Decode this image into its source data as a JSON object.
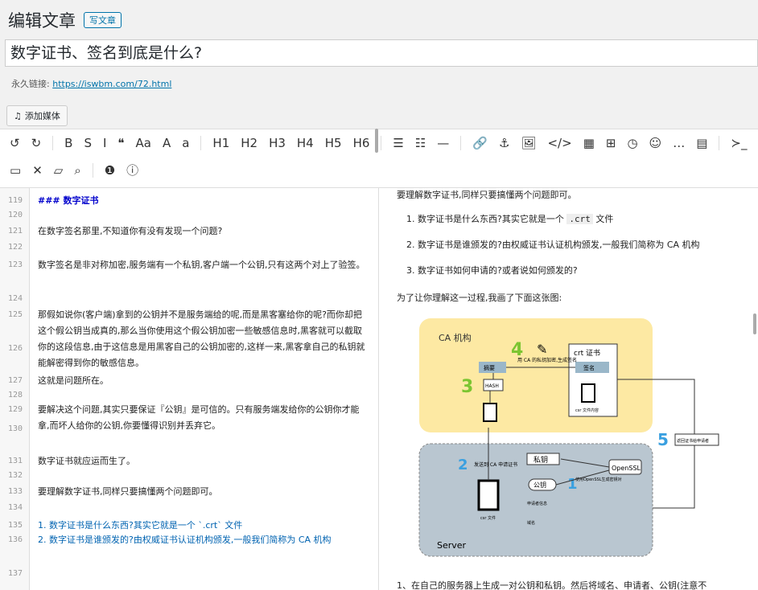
{
  "header": {
    "title": "编辑文章",
    "button": "写文章"
  },
  "post_title": "数字证书、签名到底是什么?",
  "permalink": {
    "label": "永久链接:",
    "url": "https://iswbm.com/72.html"
  },
  "media_button": "添加媒体",
  "toolbar": {
    "row1": [
      "↺",
      "↻",
      "B",
      "S",
      "I",
      "❝",
      "Aa",
      "A",
      "a",
      "H1",
      "H2",
      "H3",
      "H4",
      "H5",
      "H6",
      "☰",
      "☷",
      "—",
      "🔗",
      "⚓",
      "🖼",
      "</>",
      "▦",
      "⊞",
      "◷",
      "☺",
      "…",
      "▤",
      "≻_",
      "👁"
    ],
    "row2": [
      "▭",
      "✕",
      "▱",
      "⌕",
      "❶",
      "ⓘ"
    ]
  },
  "editor_lines": [
    {
      "n": "119",
      "t": "### 数字证书",
      "cls": "heading"
    },
    {
      "n": "120",
      "t": ""
    },
    {
      "n": "121",
      "t": "在数字签名那里,不知道你有没有发现一个问题?"
    },
    {
      "n": "122",
      "t": ""
    },
    {
      "n": "123",
      "t": "数字签名是非对称加密,服务端有一个私钥,客户端一个公钥,只有这两个对上了验签。"
    },
    {
      "n": "124",
      "t": ""
    },
    {
      "n": "125",
      "t": "那假如说你(客户端)拿到的公钥并不是服务端给的呢,而是黑客塞给你的呢?而你却把这个假公钥当成真的,那么当你使用这个假公钥加密一些敏感信息时,黑客就可以截取你的这段信息,由于这信息是用黑客自己的公钥加密的,这样一来,黑客拿自己的私钥就能解密得到你的敏感信息。"
    },
    {
      "n": "126",
      "t": ""
    },
    {
      "n": "127",
      "t": "这就是问题所在。"
    },
    {
      "n": "128",
      "t": ""
    },
    {
      "n": "129",
      "t": "要解决这个问题,其实只要保证『公钥』是可信的。只有服务端发给你的公钥你才能拿,而坏人给你的公钥,你要懂得识别并丢弃它。"
    },
    {
      "n": "130",
      "t": ""
    },
    {
      "n": "131",
      "t": "数字证书就应运而生了。"
    },
    {
      "n": "132",
      "t": ""
    },
    {
      "n": "133",
      "t": "要理解数字证书,同样只要搞懂两个问题即可。"
    },
    {
      "n": "134",
      "t": ""
    },
    {
      "n": "135",
      "t": "1. 数字证书是什么东西?其实它就是一个 `.crt` 文件",
      "cls": "list"
    },
    {
      "n": "136",
      "t": "2. 数字证书是谁颁发的?由权威证书认证机构颁发,一般我们简称为 CA 机构",
      "cls": "list"
    },
    {
      "n": "137",
      "t": ""
    }
  ],
  "preview": {
    "intro": "要理解数字证书,同样只要搞懂两个问题即可。",
    "items": [
      {
        "pre": "1. 数字证书是什么东西?其实它就是一个 ",
        "code": ".crt",
        "post": " 文件"
      },
      {
        "pre": "2. 数字证书是谁颁发的?由权威证书认证机构颁发,一般我们简称为 CA 机构",
        "code": "",
        "post": ""
      },
      {
        "pre": "3. 数字证书如何申请的?或者说如何颁发的?",
        "code": "",
        "post": ""
      }
    ],
    "para": "为了让你理解这一过程,我画了下面这张图:",
    "footer": "1、在自己的服务器上生成一对公钥和私钥。然后将域名、申请者、公钥(注意不"
  },
  "diagram": {
    "ca_label": "CA 机构",
    "server_label": "Server",
    "crt_label": "crt 证书",
    "digest": "摘要",
    "hash": "HASH",
    "encrypt_note": "用 CA 的私钥加密,生成签名",
    "sign": "签名",
    "csr_content": "csr 文件内容",
    "send_csr": "发送到 CA 申请证书",
    "private_key": "私钥",
    "public_key": "公钥",
    "openssl": "OpenSSL",
    "gen_note": "使用OpenSSL生成密钥对",
    "applicant": "申请者信息",
    "domain": "域名",
    "csr_file": "csr 文件",
    "return_note": "返回证书给申请者",
    "steps": [
      "1",
      "2",
      "3",
      "4",
      "5"
    ],
    "colors": {
      "ca_bg": "#fde9a3",
      "server_bg": "#b9c6d0",
      "step": "#3aa0e0",
      "step_green": "#7cc531"
    }
  }
}
